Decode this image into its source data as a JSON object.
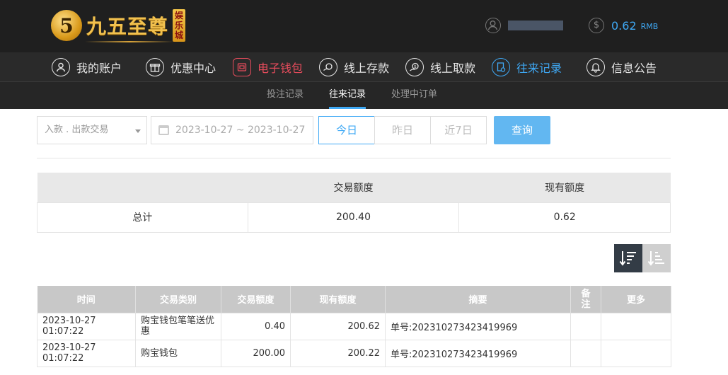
{
  "header": {
    "logo_mark": "5",
    "logo_text": "九五至尊",
    "logo_badge": "娱乐城",
    "balance": "0.62",
    "balance_unit": "RMB"
  },
  "nav": [
    {
      "label": "我的账户",
      "icon": "user-icon"
    },
    {
      "label": "优惠中心",
      "icon": "gift-icon"
    },
    {
      "label": "电子钱包",
      "icon": "wallet-icon"
    },
    {
      "label": "线上存款",
      "icon": "deposit-icon"
    },
    {
      "label": "线上取款",
      "icon": "withdraw-icon"
    },
    {
      "label": "往来记录",
      "icon": "records-icon"
    },
    {
      "label": "信息公告",
      "icon": "bell-icon"
    }
  ],
  "subnav": [
    {
      "label": "投注记录"
    },
    {
      "label": "往来记录"
    },
    {
      "label": "处理中订单"
    }
  ],
  "filters": {
    "type_value": "入款 . 出款交易",
    "date_range": "2023-10-27 ~ 2023-10-27",
    "ranges": [
      "今日",
      "昨日",
      "近7日"
    ],
    "query_label": "查询"
  },
  "summary": {
    "headers": [
      "",
      "交易额度",
      "现有额度"
    ],
    "row": [
      "总计",
      "200.40",
      "0.62"
    ]
  },
  "records": {
    "headers": [
      "时间",
      "交易类别",
      "交易额度",
      "现有额度",
      "摘要",
      "备注",
      "更多"
    ],
    "rows": [
      [
        "2023-10-27 01:07:22",
        "购宝钱包笔笔送优惠",
        "0.40",
        "200.62",
        "单号:202310273423419969",
        "",
        ""
      ],
      [
        "2023-10-27 01:07:22",
        "购宝钱包",
        "200.00",
        "200.22",
        "单号:202310273423419969",
        "",
        ""
      ]
    ]
  },
  "colors": {
    "accent": "#3fa9f5",
    "wallet_active": "#e74c5c",
    "header_bg": "#1f1f1f"
  }
}
